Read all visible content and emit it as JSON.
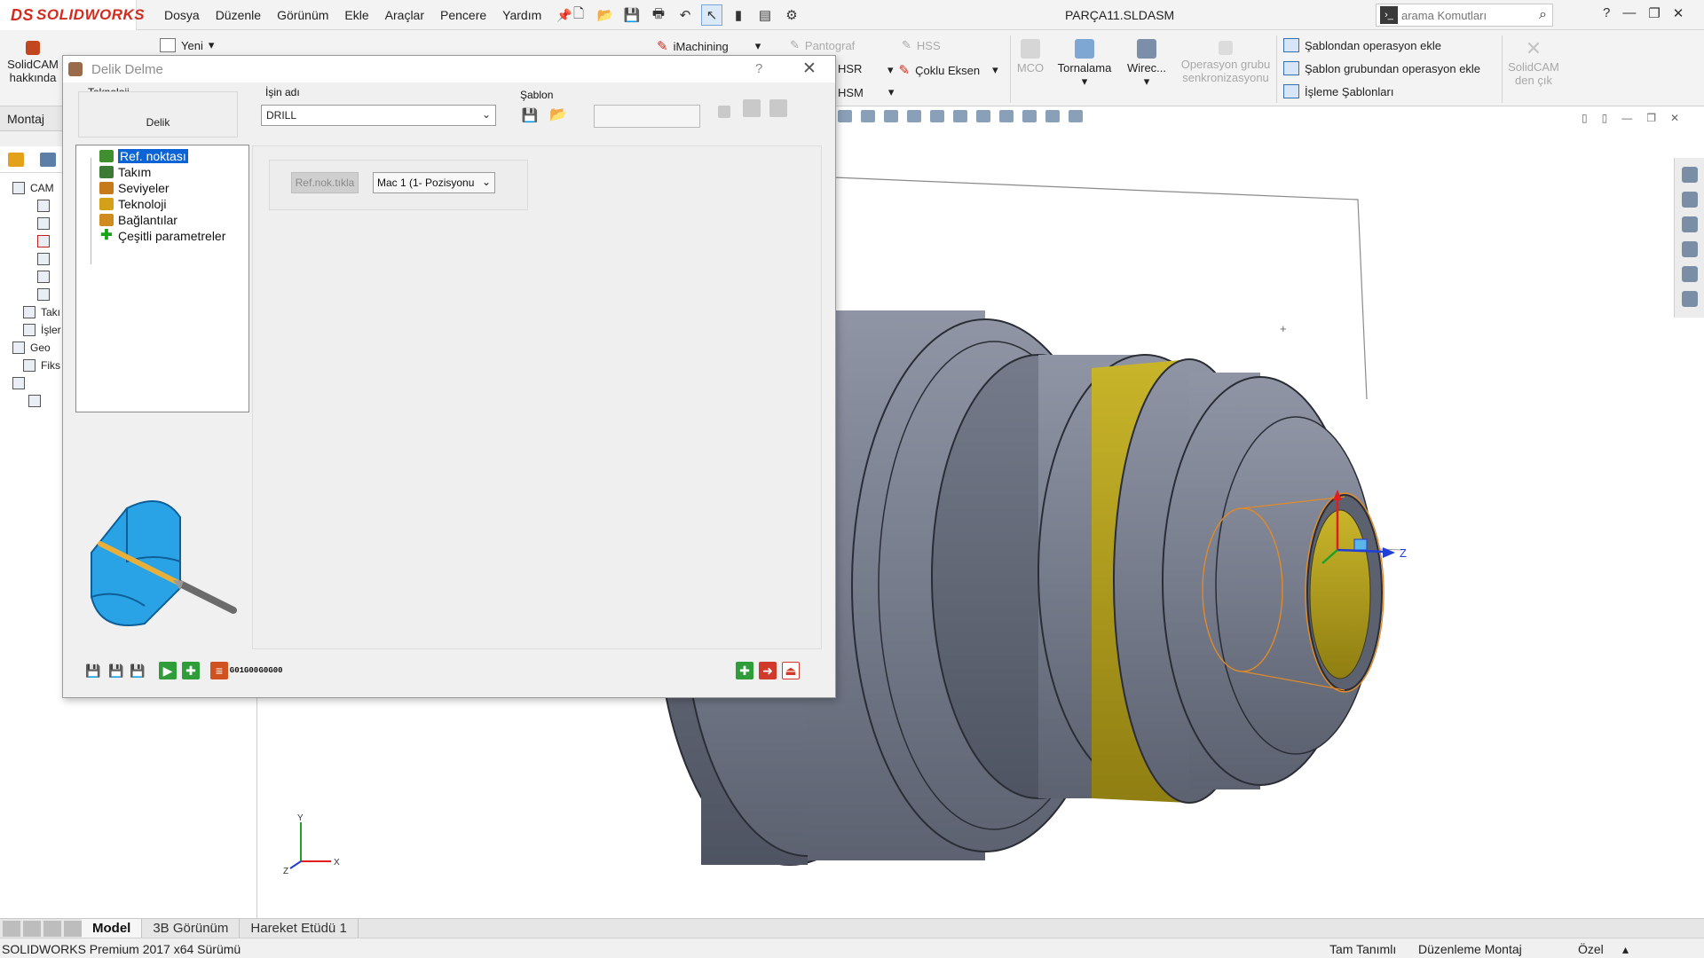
{
  "app": {
    "logo_text": "SOLIDWORKS",
    "logo_mark": "DS",
    "document_title": "PARÇA11.SLDASM",
    "search_placeholder": "arama Komutları"
  },
  "menu": [
    "Dosya",
    "Düzenle",
    "Görünüm",
    "Ekle",
    "Araçlar",
    "Pencere",
    "Yardım"
  ],
  "command_manager": {
    "solidcam_about": [
      "SolidCAM",
      "hakkında"
    ],
    "new_label": "Yeni",
    "imachining": "iMachining",
    "pantograf": "Pantograf",
    "hss": "HSS",
    "hsr": "HSR",
    "hsm": "HSM",
    "multi_axis": "Çoklu Eksen",
    "mco": "MCO",
    "turning": "Tornalama",
    "wire": "Wirec...",
    "op_group_sync": [
      "Operasyon grubu",
      "senkronizasyonu"
    ],
    "add_from_template": "Şablondan operasyon ekle",
    "add_from_template_group": "Şablon grubundan operasyon ekle",
    "machining_templates": "İşleme Şablonları",
    "solidcam_exit": [
      "SolidCAM",
      "den çık"
    ]
  },
  "left_panel": {
    "montaj_tab": "Montaj",
    "tree_items": [
      "CAM",
      "Takı",
      "İşler",
      "Geo",
      "Fiks"
    ]
  },
  "dialog": {
    "title": "Delik Delme",
    "help": "?",
    "close": "✕",
    "technology_label": "Teknoloji",
    "technology_value": "Delik",
    "job_name_label": "İşin adı",
    "job_name_value": "DRILL",
    "template_label": "Şablon",
    "tree": [
      {
        "label": "Ref. noktası",
        "selected": true,
        "color": "#3f8f2e"
      },
      {
        "label": "Takım",
        "selected": false,
        "color": "#3c7a35"
      },
      {
        "label": "Seviyeler",
        "selected": false,
        "color": "#c67a1a"
      },
      {
        "label": "Teknoloji",
        "selected": false,
        "color": "#d4a017"
      },
      {
        "label": "Bağlantılar",
        "selected": false,
        "color": "#d08b1f"
      },
      {
        "label": "Çeşitli parametreler",
        "selected": false,
        "color": "#19a319"
      }
    ],
    "ref_click_label": "Ref.nok.tıkla",
    "mac_select_value": "Mac 1 (1- Pozisyonu",
    "gcode_1": [
      "G01",
      "G00"
    ],
    "gcode_2": [
      "G0",
      "G00"
    ]
  },
  "model_tabs": [
    "Model",
    "3B Görünüm",
    "Hareket Etüdü 1"
  ],
  "status": {
    "version": "SOLIDWORKS Premium 2017 x64 Sürümü",
    "state": "Tam Tanımlı",
    "mode": "Düzenleme Montaj",
    "units": "Özel"
  },
  "axes": {
    "x": "X",
    "y": "Y",
    "z": "Z"
  },
  "colors": {
    "accent_blue": "#0a64d6",
    "brand_red": "#d52b1e",
    "part_gray": "#7c8291",
    "highlight_yellow": "#c8b418"
  }
}
